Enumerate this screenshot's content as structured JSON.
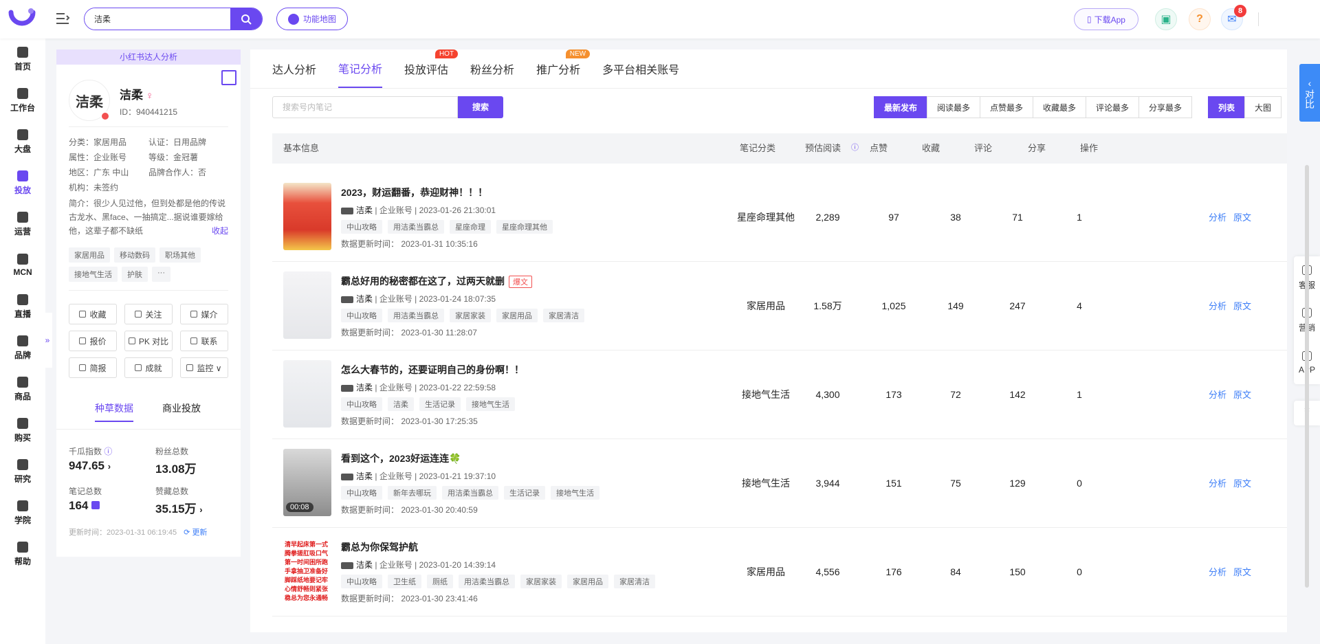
{
  "topbar": {
    "search_value": "洁柔",
    "func_map_label": "功能地图",
    "download_app_label": "下载App",
    "mail_count": "8"
  },
  "leftnav": {
    "items": [
      {
        "label": "首页",
        "icon": "home-icon"
      },
      {
        "label": "工作台",
        "icon": "workbench-icon"
      },
      {
        "label": "大盘",
        "icon": "pie-chart-icon"
      },
      {
        "label": "投放",
        "icon": "folder-icon"
      },
      {
        "label": "运营",
        "icon": "chart-icon"
      },
      {
        "label": "MCN",
        "icon": "building-icon"
      },
      {
        "label": "直播",
        "icon": "video-icon"
      },
      {
        "label": "品牌",
        "icon": "brand-icon"
      },
      {
        "label": "商品",
        "icon": "bag-icon"
      },
      {
        "label": "购买",
        "icon": "cart-icon"
      },
      {
        "label": "研究",
        "icon": "flask-icon"
      },
      {
        "label": "学院",
        "icon": "graduation-icon"
      },
      {
        "label": "帮助",
        "icon": "help-icon"
      }
    ],
    "active_index": 3
  },
  "profile": {
    "header": "小红书达人分析",
    "avatar_text": "洁柔",
    "name": "洁柔",
    "id_text": "ID：940441215",
    "fields": {
      "category": "分类：家居用品",
      "cert": "认证：日用品牌",
      "attr": "属性：企业账号",
      "level": "等级：金冠薯",
      "region": "地区：广东 中山",
      "brand_partner": "品牌合作人：否",
      "org": "机构：未签约"
    },
    "intro": "简介：很少人见过他，但到处都是他的传说古龙水、黑face、一抽搞定...据说谁要嫁给他，这辈子都不缺纸",
    "fold_label": "收起",
    "tags": [
      "家居用品",
      "移动数码",
      "职场其他",
      "接地气生活",
      "护肤",
      "···"
    ],
    "actions": [
      "收藏",
      "关注",
      "媒介",
      "报价",
      "PK 对比",
      "联系",
      "简报",
      "成就",
      "监控 ∨"
    ],
    "tabs": [
      "种草数据",
      "商业投放"
    ],
    "stats": {
      "qiangua_label": "千瓜指数",
      "qiangua_value": "947.65",
      "fans_label": "粉丝总数",
      "fans_value": "13.08万",
      "notes_label": "笔记总数",
      "notes_value": "164",
      "likes_label": "赞藏总数",
      "likes_value": "35.15万"
    },
    "updated": "更新时间：2023-01-31 06:19:45",
    "update_link": "更新"
  },
  "main": {
    "tabs": [
      {
        "label": "达人分析",
        "badge": ""
      },
      {
        "label": "笔记分析",
        "badge": ""
      },
      {
        "label": "投放评估",
        "badge": "HOT"
      },
      {
        "label": "粉丝分析",
        "badge": ""
      },
      {
        "label": "推广分析",
        "badge": "NEW"
      },
      {
        "label": "多平台相关账号",
        "badge": ""
      }
    ],
    "search_placeholder": "搜索号内笔记",
    "search_button": "搜索",
    "sorts": [
      "最新发布",
      "阅读最多",
      "点赞最多",
      "收藏最多",
      "评论最多",
      "分享最多"
    ],
    "views": [
      "列表",
      "大图"
    ],
    "columns": [
      "基本信息",
      "笔记分类",
      "预估阅读",
      "点赞",
      "收藏",
      "评论",
      "分享",
      "操作"
    ],
    "rows": [
      {
        "title": "2023，财运翻番，恭迎财神！！！",
        "badge": "",
        "author": "洁柔",
        "account": "企业账号",
        "time": "2023-01-26 21:30:01",
        "tags": [
          "中山攻略",
          "用洁柔当霸总",
          "星座命理",
          "星座命理其他"
        ],
        "updated": "数据更新时间：  2023-01-31 10:35:16",
        "category": "星座命理其他",
        "reads": "2,289",
        "likes": "97",
        "favs": "38",
        "comments": "71",
        "shares": "1"
      },
      {
        "title": "霸总好用的秘密都在这了，过两天就删",
        "badge": "爆文",
        "author": "洁柔",
        "account": "企业账号",
        "time": "2023-01-24 18:07:35",
        "tags": [
          "中山攻略",
          "用洁柔当霸总",
          "家居家装",
          "家居用品",
          "家居清洁"
        ],
        "updated": "数据更新时间：  2023-01-30 11:28:07",
        "category": "家居用品",
        "reads": "1.58万",
        "likes": "1,025",
        "favs": "149",
        "comments": "247",
        "shares": "4"
      },
      {
        "title": "怎么大春节的，还要证明自己的身份啊！！",
        "badge": "",
        "author": "洁柔",
        "account": "企业账号",
        "time": "2023-01-22 22:59:58",
        "tags": [
          "中山攻略",
          "洁柔",
          "生活记录",
          "接地气生活"
        ],
        "updated": "数据更新时间：  2023-01-30 17:25:35",
        "category": "接地气生活",
        "reads": "4,300",
        "likes": "173",
        "favs": "72",
        "comments": "142",
        "shares": "1"
      },
      {
        "title": "看到这个，2023好运连连🍀",
        "badge": "",
        "author": "洁柔",
        "account": "企业账号",
        "time": "2023-01-21 19:37:10",
        "tags": [
          "中山攻略",
          "新年去哪玩",
          "用洁柔当霸总",
          "生活记录",
          "接地气生活"
        ],
        "updated": "数据更新时间：  2023-01-30 20:40:59",
        "category": "接地气生活",
        "reads": "3,944",
        "likes": "151",
        "favs": "75",
        "comments": "129",
        "shares": "0",
        "duration": "00:08"
      },
      {
        "title": "霸总为你保驾护航",
        "badge": "",
        "author": "洁柔",
        "account": "企业账号",
        "time": "2023-01-20 14:39:14",
        "tags": [
          "中山攻略",
          "卫生纸",
          "厕纸",
          "用洁柔当霸总",
          "家居家装",
          "家居用品",
          "家居清洁"
        ],
        "updated": "数据更新时间：  2023-01-30 23:41:46",
        "category": "家居用品",
        "reads": "4,556",
        "likes": "176",
        "favs": "84",
        "comments": "150",
        "shares": "0"
      }
    ],
    "op_analyze": "分析",
    "op_original": "原文"
  },
  "thumb5_text": "清早起床第一式腾拳搓肛吸口气第一时间困所跑手拿抽卫准备好脚踩纸地要记牢心情舒畅则紧张稳总为您永通畅",
  "right_float": {
    "compare_label": "对比",
    "items": [
      "客服",
      "营销",
      "APP"
    ]
  },
  "colors": {
    "accent": "#6a48f0",
    "link": "#3d7ef7",
    "hot": "#f5432f",
    "new": "#f5902f"
  }
}
